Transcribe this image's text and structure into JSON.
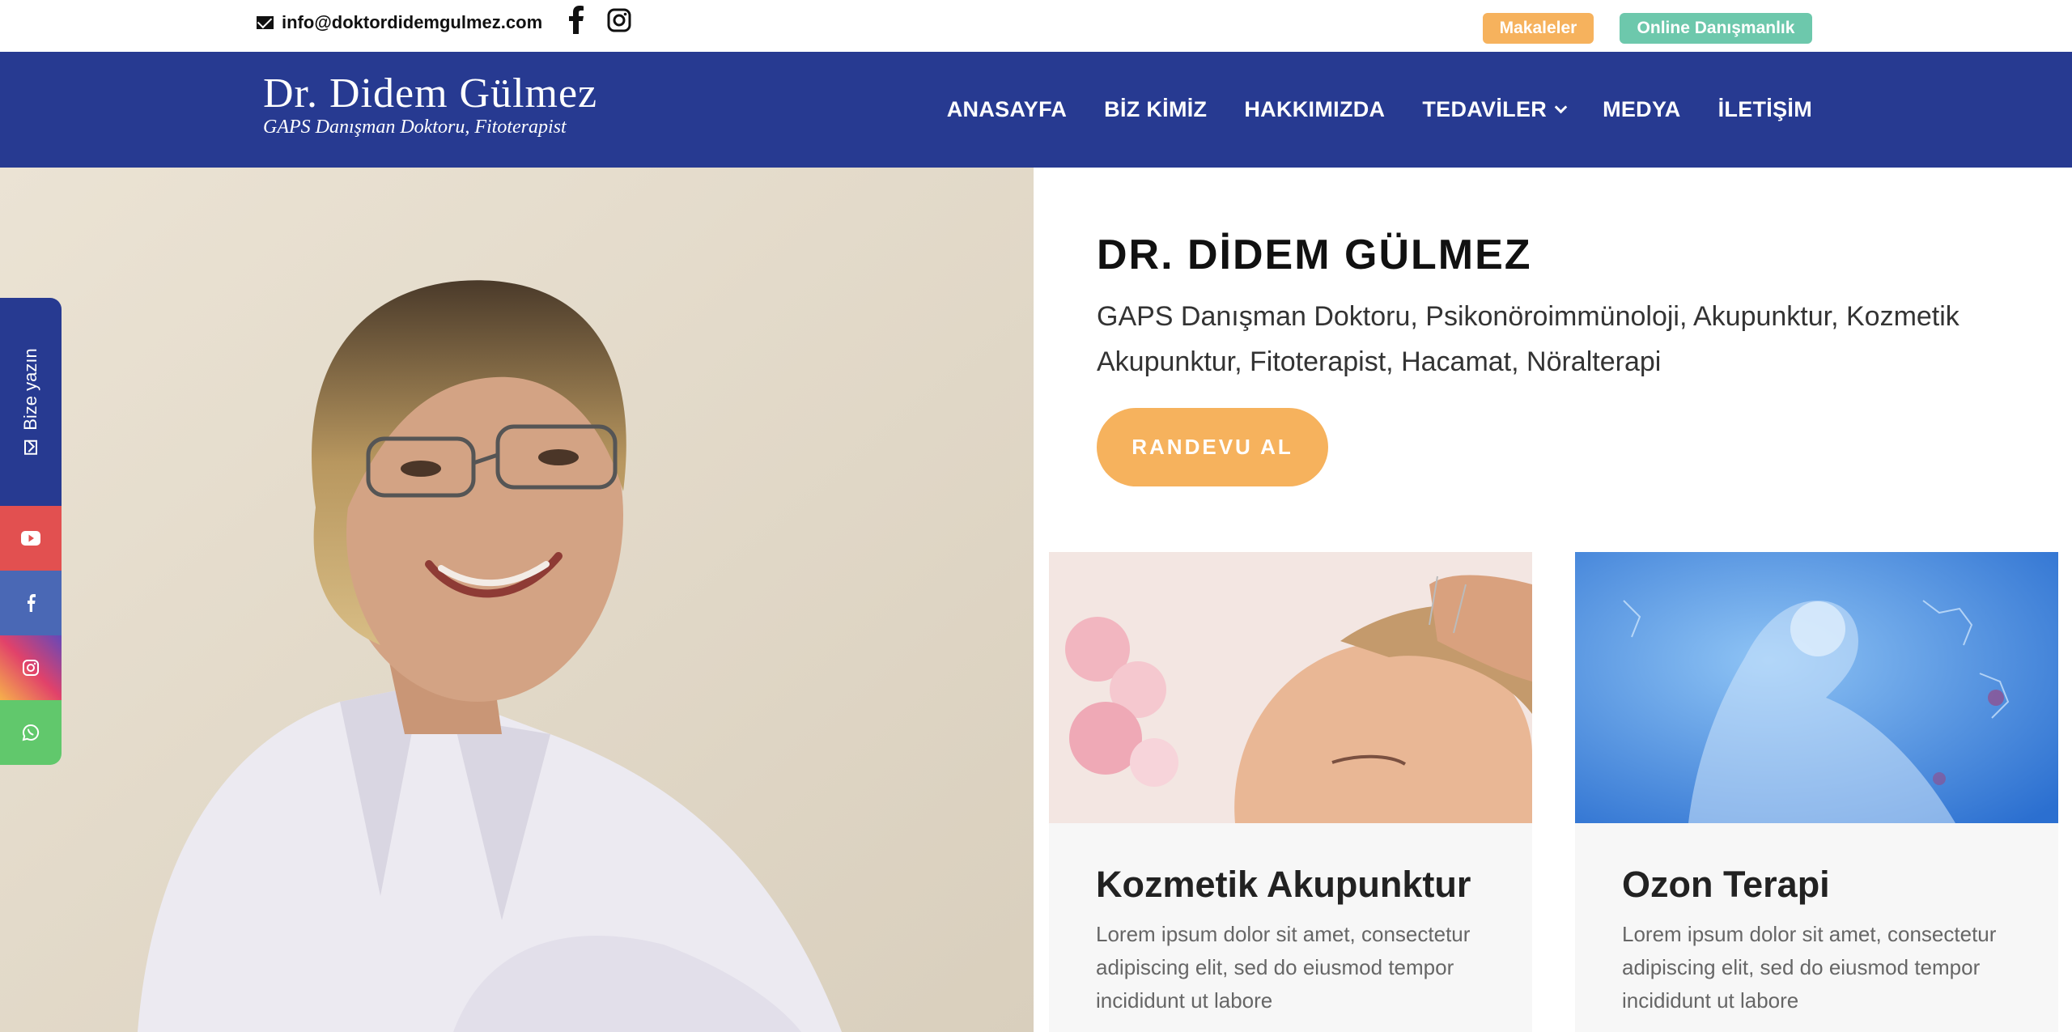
{
  "topbar": {
    "email": "info@doktordidemgulmez.com",
    "email_icon": "envelope-icon",
    "facebook_icon": "facebook-icon",
    "instagram_icon": "instagram-icon",
    "articles_label": "Makaleler",
    "online_label": "Online Danışmanlık"
  },
  "header": {
    "logo_name": "Dr. Didem Gülmez",
    "logo_subtitle": "GAPS Danışman Doktoru, Fitoterapist",
    "nav": [
      {
        "label": "ANASAYFA"
      },
      {
        "label": "BİZ KİMİZ"
      },
      {
        "label": "HAKKIMIZDA"
      },
      {
        "label": "TEDAVİLER",
        "icon": "chevron-down-icon"
      },
      {
        "label": "MEDYA"
      },
      {
        "label": "İLETİŞİM"
      }
    ]
  },
  "hero": {
    "title": "DR. DİDEM GÜLMEZ",
    "subtitle": "GAPS Danışman Doktoru, Psikonöroimmünoloji, Akupunktur, Kozmetik Akupunktur, Fitoterapist, Hacamat, Nöralterapi",
    "cta_label": "RANDEVU AL"
  },
  "cards": [
    {
      "title": "Kozmetik Akupunktur",
      "text": "Lorem ipsum dolor sit amet, consectetur adipiscing elit, sed do eiusmod tempor incididunt ut labore"
    },
    {
      "title": "Ozon Terapi",
      "text": "Lorem ipsum dolor sit amet, consectetur adipiscing elit, sed do eiusmod tempor incididunt ut labore"
    }
  ],
  "side_widget": {
    "write_label": "Bize yazın",
    "buttons": [
      "youtube-icon",
      "facebook-icon",
      "instagram-icon",
      "whatsapp-icon"
    ]
  },
  "colors": {
    "header_blue": "#273a91",
    "accent_orange": "#f6b25d",
    "accent_green": "#6dc8ac"
  }
}
